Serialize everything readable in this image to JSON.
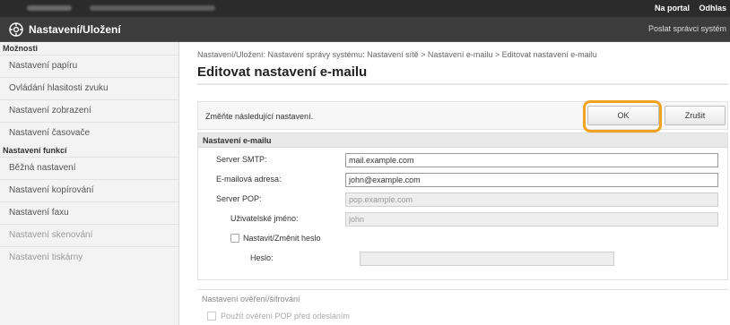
{
  "header": {
    "portal_link": "Na portal",
    "logout_link": "Odhlas",
    "title": "Nastavení/Uložení",
    "send_link": "Poslat správci systém"
  },
  "sidebar": {
    "section1": "Možnosti",
    "items1": [
      {
        "label": "Nastavení papíru"
      },
      {
        "label": "Ovládání hlasitosti zvuku"
      },
      {
        "label": "Nastavení zobrazení"
      },
      {
        "label": "Nastavení časovače"
      }
    ],
    "section2": "Nastavení funkcí",
    "items2": [
      {
        "label": "Běžná nastavení"
      },
      {
        "label": "Nastavení kopírování"
      },
      {
        "label": "Nastavení faxu"
      },
      {
        "label": "Nastavení skenování"
      },
      {
        "label": "Nastavení tiskárny"
      }
    ]
  },
  "main": {
    "breadcrumb": "Nastavení/Uložení: Nastavení správy systému: Nastavení sítě > Nastavení e-mailu > Editovat nastavení e-mailu",
    "page_title": "Editovat nastavení e-mailu",
    "change_note": "Změňte následující nastavení.",
    "ok_label": "OK",
    "cancel_label": "Zrušit",
    "email_section_title": "Nastavení e-mailu",
    "smtp_label": "Server SMTP:",
    "smtp_value": "mail.example.com",
    "email_label": "E-mailová adresa:",
    "email_value": "john@example.com",
    "pop_label": "Server POP:",
    "pop_value": "pop.example.com",
    "user_label": "Uživatelské jméno:",
    "user_value": "john",
    "setpw_label": "Nastavit/Změnit heslo",
    "password_label": "Heslo:",
    "password_value": "",
    "auth_section_title": "Nastavení ověření/šifrování",
    "pop_auth_label": "Použít ověření POP před odesláním"
  }
}
